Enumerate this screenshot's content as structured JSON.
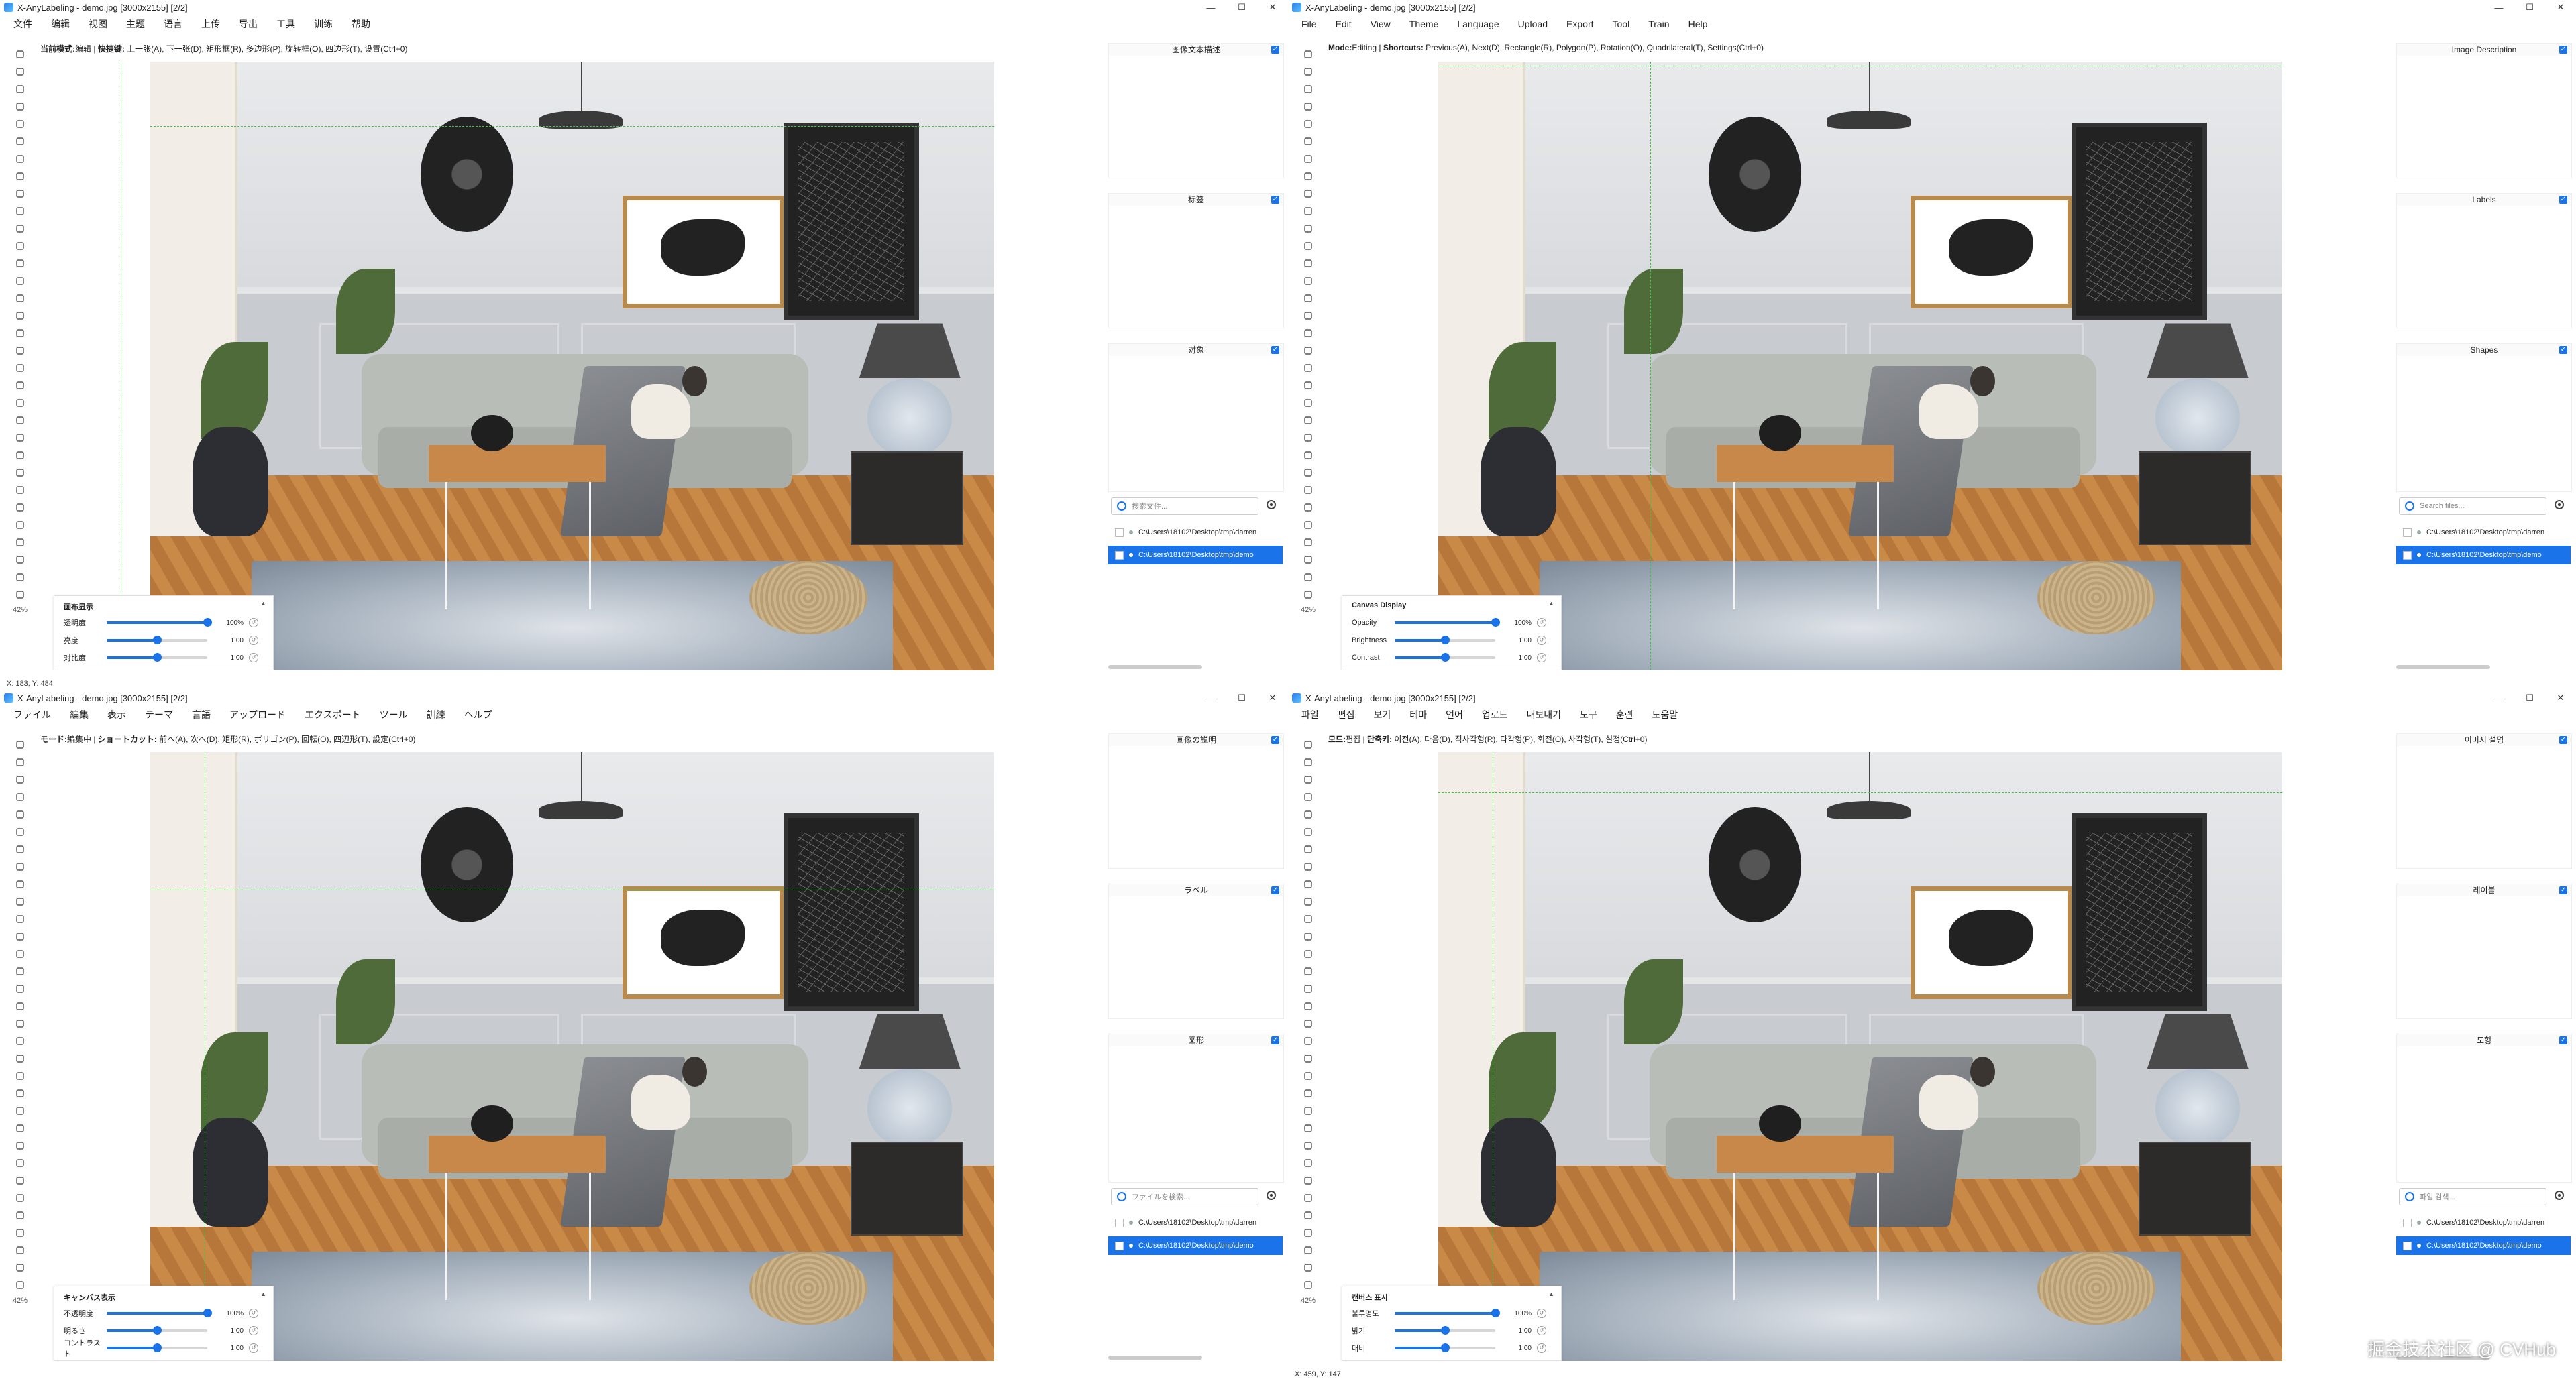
{
  "window": {
    "title": "X-AnyLabeling - demo.jpg [3000x2155] [2/2]",
    "minimize": "—",
    "maximize": "☐",
    "close": "✕"
  },
  "zoom_value": "42%",
  "colors": {
    "accent": "#1a73e8",
    "guide": "#3cc83c"
  },
  "tool_icons": [
    "open-file-icon",
    "next-image-icon",
    "prev-image-icon",
    "save-icon",
    "delete-icon",
    "polygon-icon",
    "brush-icon",
    "ai-icon",
    "rectangle-icon",
    "rotation-icon",
    "quadrilateral-icon",
    "circle-icon",
    "line-icon",
    "point-icon",
    "linestrip-icon",
    "edit-icon",
    "copy-icon",
    "undo-icon",
    "redo-icon",
    "group-icon",
    "eye-icon",
    "crosshair-icon",
    "zoom-in-icon",
    "zoom-out-icon",
    "fit-icon",
    "overview-icon",
    "shortcut-icon",
    "settings-icon",
    "camera-icon",
    "brightness-icon",
    "info-icon",
    "layers-icon"
  ],
  "file_items": [
    "C:\\Users\\18102\\Desktop\\tmp\\darren",
    "C:\\Users\\18102\\Desktop\\tmp\\demo"
  ],
  "panes": [
    {
      "menus": [
        "文件",
        "编辑",
        "视图",
        "主题",
        "语言",
        "上传",
        "导出",
        "工具",
        "训练",
        "帮助"
      ],
      "mode": {
        "label": "当前模式:",
        "value": "编辑",
        "sep": " | ",
        "shortcut_label": "快捷键:",
        "text": " 上一张(A), 下一张(D), 矩形框(R), 多边形(P), 旋转框(O), 四边形(T), 设置(Ctrl+0)"
      },
      "docks": {
        "description": "图像文本描述",
        "labels": "标签",
        "shapes": "对象"
      },
      "search_placeholder": "搜索文件...",
      "canvas_display": {
        "title": "画布显示",
        "opacity": "透明度",
        "brightness": "亮度",
        "contrast": "对比度",
        "opacity_value": "100%",
        "brightness_value": "1.00",
        "contrast_value": "1.00",
        "opacity_level": 1.0,
        "brightness_level": 0.5,
        "contrast_level": 0.5
      },
      "status": "X: 183, Y: 484"
    },
    {
      "menus": [
        "File",
        "Edit",
        "View",
        "Theme",
        "Language",
        "Upload",
        "Export",
        "Tool",
        "Train",
        "Help"
      ],
      "mode": {
        "label": "Mode:",
        "value": "Editing",
        "sep": " | ",
        "shortcut_label": "Shortcuts:",
        "text": " Previous(A), Next(D), Rectangle(R), Polygon(P), Rotation(O), Quadrilateral(T), Settings(Ctrl+0)"
      },
      "docks": {
        "description": "Image Description",
        "labels": "Labels",
        "shapes": "Shapes"
      },
      "search_placeholder": "Search files...",
      "canvas_display": {
        "title": "Canvas Display",
        "opacity": "Opacity",
        "brightness": "Brightness",
        "contrast": "Contrast",
        "opacity_value": "100%",
        "brightness_value": "1.00",
        "contrast_value": "1.00",
        "opacity_level": 1.0,
        "brightness_level": 0.5,
        "contrast_level": 0.5
      },
      "status": ""
    },
    {
      "menus": [
        "ファイル",
        "編集",
        "表示",
        "テーマ",
        "言語",
        "アップロード",
        "エクスポート",
        "ツール",
        "訓練",
        "ヘルプ"
      ],
      "mode": {
        "label": "モード:",
        "value": "編集中",
        "sep": " | ",
        "shortcut_label": "ショートカット:",
        "text": " 前へ(A), 次へ(D), 矩形(R), ポリゴン(P), 回転(O), 四辺形(T), 設定(Ctrl+0)"
      },
      "docks": {
        "description": "画像の説明",
        "labels": "ラベル",
        "shapes": "図形"
      },
      "search_placeholder": "ファイルを検索...",
      "canvas_display": {
        "title": "キャンバス表示",
        "opacity": "不透明度",
        "brightness": "明るさ",
        "contrast": "コントラスト",
        "opacity_value": "100%",
        "brightness_value": "1.00",
        "contrast_value": "1.00",
        "opacity_level": 1.0,
        "brightness_level": 0.5,
        "contrast_level": 0.5
      },
      "status": ""
    },
    {
      "menus": [
        "파일",
        "편집",
        "보기",
        "테마",
        "언어",
        "업로드",
        "내보내기",
        "도구",
        "훈련",
        "도움말"
      ],
      "mode": {
        "label": "모드:",
        "value": "편집",
        "sep": " | ",
        "shortcut_label": "단축키:",
        "text": " 이전(A), 다음(D), 직사각형(R), 다각형(P), 회전(O), 사각형(T), 설정(Ctrl+0)"
      },
      "docks": {
        "description": "이미지 설명",
        "labels": "레이블",
        "shapes": "도형"
      },
      "search_placeholder": "파일 검색...",
      "canvas_display": {
        "title": "캔버스 표시",
        "opacity": "불투명도",
        "brightness": "밝기",
        "contrast": "대비",
        "opacity_value": "100%",
        "brightness_value": "1.00",
        "contrast_value": "1.00",
        "opacity_level": 1.0,
        "brightness_level": 0.5,
        "contrast_level": 0.5
      },
      "status": "X: 459, Y: 147"
    }
  ],
  "watermark": "掘金技术社区 @ CVHub"
}
